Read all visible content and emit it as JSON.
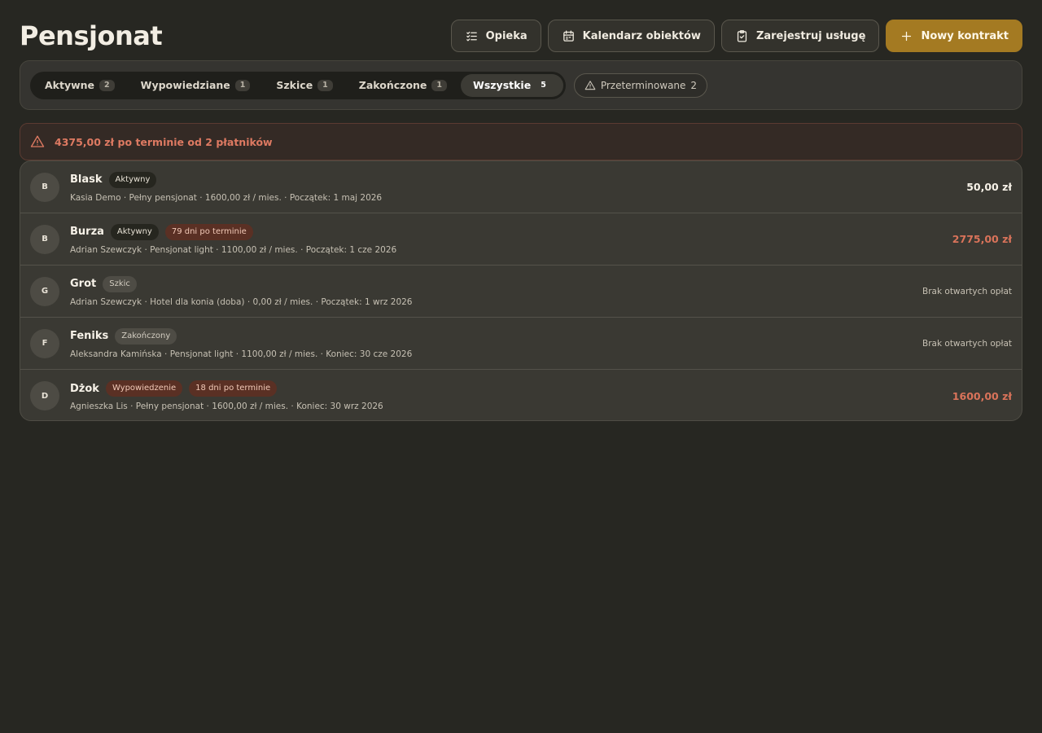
{
  "header": {
    "title": "Pensjonat",
    "buttons": {
      "opieka": "Opieka",
      "kalendarz": "Kalendarz obiektów",
      "zarejestruj": "Zarejestruj usługę",
      "nowy": "Nowy kontrakt"
    }
  },
  "tabs": [
    {
      "label": "Aktywne",
      "count": "2"
    },
    {
      "label": "Wypowiedziane",
      "count": "1"
    },
    {
      "label": "Szkice",
      "count": "1"
    },
    {
      "label": "Zakończone",
      "count": "1"
    },
    {
      "label": "Wszystkie",
      "count": "5"
    }
  ],
  "active_tab": "Wszystkie",
  "overdue_filter": {
    "label": "Przeterminowane",
    "count": "2"
  },
  "alert": {
    "text": "4375,00 zł po terminie od 2 płatników"
  },
  "rows": [
    {
      "initial": "B",
      "name": "Blask",
      "badges": [
        {
          "text": "Aktywny",
          "kind": "aktywny"
        }
      ],
      "meta": "Kasia Demo · Pełny pensjonat · 1600,00 zł / mies. · Początek: 1 maj 2026",
      "amount": "50,00 zł",
      "amount_style": "normal"
    },
    {
      "initial": "B",
      "name": "Burza",
      "badges": [
        {
          "text": "Aktywny",
          "kind": "aktywny"
        },
        {
          "text": "79 dni po terminie",
          "kind": "overdue"
        }
      ],
      "meta": "Adrian Szewczyk · Pensjonat light · 1100,00 zł / mies. · Początek: 1 cze 2026",
      "amount": "2775,00 zł",
      "amount_style": "red"
    },
    {
      "initial": "G",
      "name": "Grot",
      "badges": [
        {
          "text": "Szkic",
          "kind": "szkic"
        }
      ],
      "meta": "Adrian Szewczyk · Hotel dla konia (doba) · 0,00 zł / mies. · Początek: 1 wrz 2026",
      "amount": "Brak otwartych opłat",
      "amount_style": "muted"
    },
    {
      "initial": "F",
      "name": "Feniks",
      "badges": [
        {
          "text": "Zakończony",
          "kind": "zakonczony"
        }
      ],
      "meta": "Aleksandra Kamińska · Pensjonat light · 1100,00 zł / mies. · Koniec: 30 cze 2026",
      "amount": "Brak otwartych opłat",
      "amount_style": "muted"
    },
    {
      "initial": "D",
      "name": "Dżok",
      "badges": [
        {
          "text": "Wypowiedzenie",
          "kind": "wypowiedzenie"
        },
        {
          "text": "18 dni po terminie",
          "kind": "overdue"
        }
      ],
      "meta": "Agnieszka Lis · Pełny pensjonat · 1600,00 zł / mies. · Koniec: 30 wrz 2026",
      "amount": "1600,00 zł",
      "amount_style": "red"
    }
  ],
  "colors": {
    "background": "#272722",
    "primary_button": "#a47a22",
    "danger_text": "#de7a62",
    "overdue_badge": "#5a3024"
  },
  "icons": {
    "opieka": "checklist-icon",
    "kalendarz": "calendar-icon",
    "zarejestruj": "clipboard-check-icon",
    "nowy": "plus-icon",
    "overdue": "warning-triangle-icon",
    "alert": "warning-triangle-icon"
  }
}
